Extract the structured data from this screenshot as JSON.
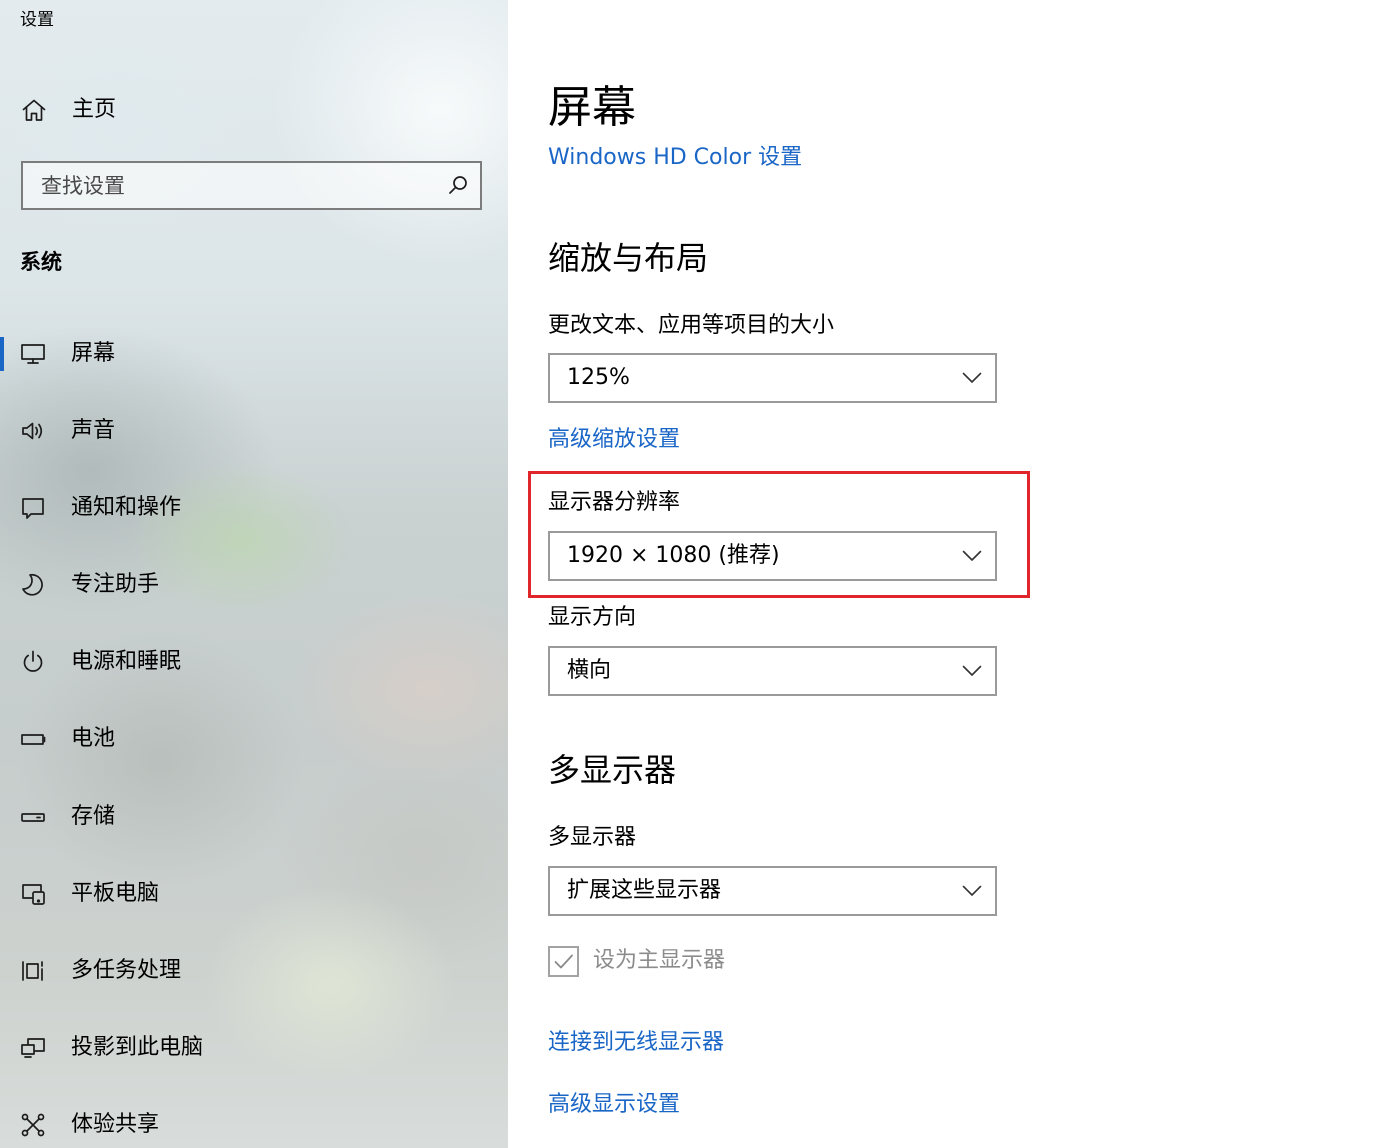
{
  "window": {
    "title": "设置"
  },
  "sidebar": {
    "home_label": "主页",
    "home_icon": "home-icon",
    "search": {
      "placeholder": "查找设置",
      "icon": "search-icon"
    },
    "section_title": "系统",
    "items": [
      {
        "label": "屏幕",
        "icon": "display-icon",
        "selected": true
      },
      {
        "label": "声音",
        "icon": "speaker-icon"
      },
      {
        "label": "通知和操作",
        "icon": "notification-icon"
      },
      {
        "label": "专注助手",
        "icon": "moon-icon"
      },
      {
        "label": "电源和睡眠",
        "icon": "power-icon"
      },
      {
        "label": "电池",
        "icon": "battery-icon"
      },
      {
        "label": "存储",
        "icon": "storage-icon"
      },
      {
        "label": "平板电脑",
        "icon": "tablet-icon"
      },
      {
        "label": "多任务处理",
        "icon": "multitasking-icon"
      },
      {
        "label": "投影到此电脑",
        "icon": "project-icon"
      },
      {
        "label": "体验共享",
        "icon": "share-icon"
      }
    ]
  },
  "main": {
    "page_title": "屏幕",
    "hd_color_link": "Windows HD Color 设置",
    "dropdown_icon": "chevron-down-icon",
    "scale_and_layout": {
      "heading": "缩放与布局",
      "scale_label": "更改文本、应用等项目的大小",
      "scale_value": "125%",
      "advanced_scaling_link": "高级缩放设置",
      "resolution_label": "显示器分辨率",
      "resolution_value": "1920 × 1080 (推荐)",
      "orientation_label": "显示方向",
      "orientation_value": "横向"
    },
    "multiple_displays": {
      "heading": "多显示器",
      "label": "多显示器",
      "value": "扩展这些显示器",
      "make_main_label": "设为主显示器",
      "make_main_checked": true,
      "make_main_disabled": true,
      "check_icon": "checkmark-icon",
      "wireless_link": "连接到无线显示器",
      "advanced_display_link": "高级显示设置"
    }
  },
  "colors": {
    "accent": "#1a66c7",
    "highlight_box": "#e0262b",
    "dropdown_border": "#9a9a9a",
    "disabled_text": "#8c8c8c"
  }
}
